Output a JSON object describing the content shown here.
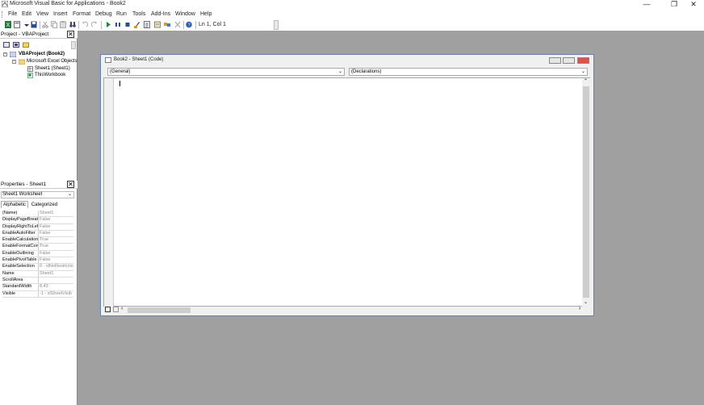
{
  "window": {
    "title": "Microsoft Visual Basic for Applications - Book2",
    "minimize": "—",
    "restore": "❐",
    "close": "✕"
  },
  "menu": [
    "File",
    "Edit",
    "View",
    "Insert",
    "Format",
    "Debug",
    "Run",
    "Tools",
    "Add-Ins",
    "Window",
    "Help"
  ],
  "toolbar": {
    "position": "Ln 1, Col 1"
  },
  "project_pane": {
    "title": "Project - VBAProject",
    "close": "✕",
    "tree": {
      "root": "VBAProject (Book2)",
      "folder": "Microsoft Excel Objects",
      "items": [
        "Sheet1 (Sheet1)",
        "ThisWorkbook"
      ]
    }
  },
  "properties_pane": {
    "title": "Properties - Sheet1",
    "close": "✕",
    "object_select": "Sheet1 Worksheet",
    "tabs": [
      "Alphabetic",
      "Categorized"
    ],
    "rows": [
      {
        "name": "(Name)",
        "value": "Sheet1"
      },
      {
        "name": "DisplayPageBreak",
        "value": "False"
      },
      {
        "name": "DisplayRightToLeft",
        "value": "False"
      },
      {
        "name": "EnableAutoFilter",
        "value": "False"
      },
      {
        "name": "EnableCalculation",
        "value": "True"
      },
      {
        "name": "EnableFormatCon",
        "value": "True"
      },
      {
        "name": "EnableOutlining",
        "value": "False"
      },
      {
        "name": "EnablePivotTable",
        "value": "False"
      },
      {
        "name": "EnableSelection",
        "value": "0 - xlNoRestrictio"
      },
      {
        "name": "Name",
        "value": "Sheet1"
      },
      {
        "name": "ScrollArea",
        "value": ""
      },
      {
        "name": "StandardWidth",
        "value": "8.43"
      },
      {
        "name": "Visible",
        "value": "-1 - xlSheetVisib"
      }
    ]
  },
  "code_window": {
    "title": "Book2 - Sheet1 (Code)",
    "object_dropdown": "(General)",
    "procedure_dropdown": "(Declarations)"
  },
  "colors": {
    "background": "#a0a0a0",
    "close_red": "#d9534f"
  }
}
